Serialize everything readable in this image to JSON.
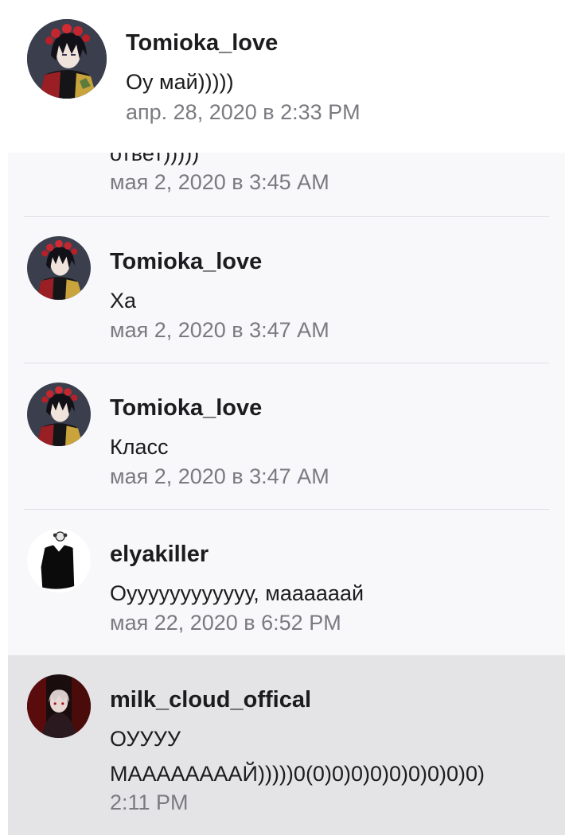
{
  "pinned_comment": {
    "username": "Tomioka_love",
    "text": "Оу май)))))",
    "timestamp": "апр. 28, 2020 в 2:33 PM",
    "avatar": "tomioka-avatar"
  },
  "partial_comment": {
    "text": "ответ)))))",
    "timestamp": "мая 2, 2020 в 3:45 AM"
  },
  "comments": [
    {
      "username": "Tomioka_love",
      "text": "Ха",
      "timestamp": "мая 2, 2020 в 3:47 AM",
      "avatar": "tomioka-avatar"
    },
    {
      "username": "Tomioka_love",
      "text": "Класс",
      "timestamp": "мая 2, 2020 в 3:47 AM",
      "avatar": "tomioka-avatar"
    },
    {
      "username": "elyakiller",
      "text": "Оуууууууууууу, маааааай",
      "timestamp": "мая 22, 2020 в 6:52 PM",
      "avatar": "elyakiller-avatar"
    },
    {
      "username": "milk_cloud_offical",
      "text_line1": "ОУУУУ",
      "text_line2": "МААААААААЙ)))))0(0)0)0)0)0)0)0)0)0)",
      "timestamp": "2:11 PM",
      "avatar": "milk-cloud-avatar"
    }
  ],
  "colors": {
    "text_primary": "#1c1c1e",
    "text_secondary": "#7a7a80",
    "list_background": "#f8f7fa",
    "highlight_background": "#e4e3e6",
    "divider": "#e1dfe4"
  }
}
